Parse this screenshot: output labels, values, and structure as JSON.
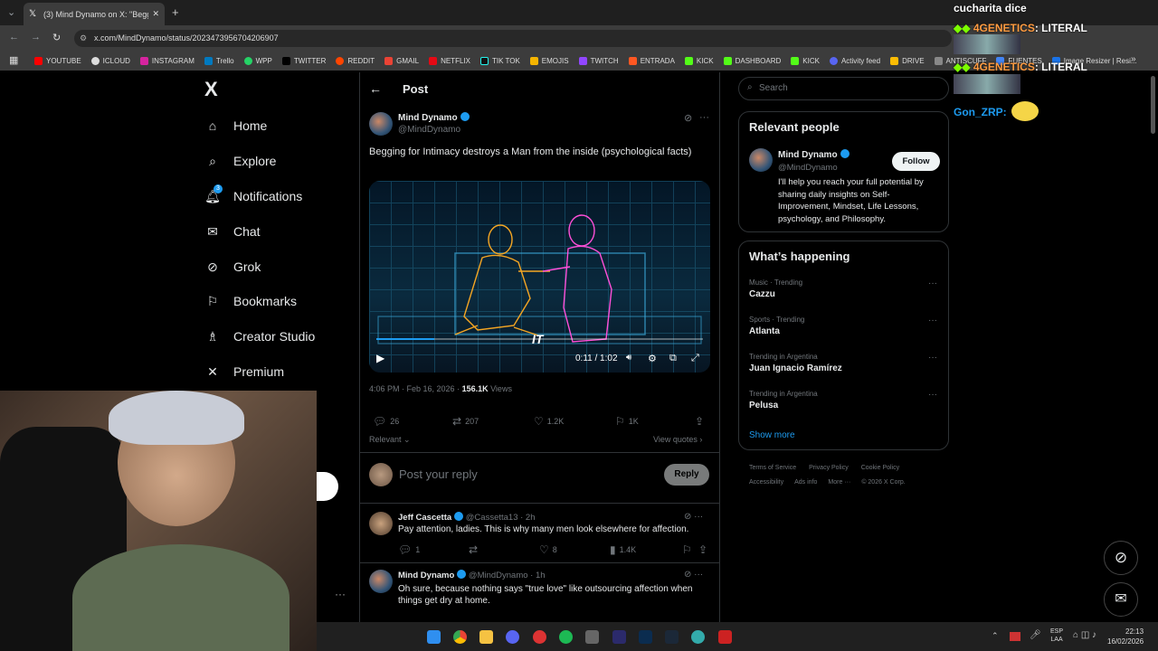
{
  "browser": {
    "tab_title": "(3) Mind Dynamo on X: \"Beggi",
    "url": "x.com/MindDynamo/status/2023473956704206907",
    "bookmarks": [
      "YOUTUBE",
      "ICLOUD",
      "INSTAGRAM",
      "Trello",
      "WPP",
      "TWITTER",
      "REDDIT",
      "GMAIL",
      "NETFLIX",
      "TIK TOK",
      "EMOJIS",
      "TWITCH",
      "ENTRADA",
      "KICK",
      "DASHBOARD",
      "KICK",
      "Activity feed",
      "DRIVE",
      "ANTISCUFF",
      "FUENTES",
      "Image Resizer | Resi..."
    ]
  },
  "sidebar": {
    "logo": "X",
    "items": [
      {
        "label": "Home",
        "icon": "home-icon"
      },
      {
        "label": "Explore",
        "icon": "search-icon"
      },
      {
        "label": "Notifications",
        "icon": "bell-icon"
      },
      {
        "label": "Chat",
        "icon": "mail-icon"
      },
      {
        "label": "Grok",
        "icon": "grok-icon"
      },
      {
        "label": "Bookmarks",
        "icon": "bookmark-icon"
      },
      {
        "label": "Creator Studio",
        "icon": "creator-icon"
      },
      {
        "label": "Premium",
        "icon": "x-icon"
      }
    ],
    "notification_count": "3"
  },
  "post": {
    "header": "Post",
    "author_name": "Mind Dynamo",
    "author_handle": "@MindDynamo",
    "text": "Begging for Intimacy destroys a Man from the inside (psychological facts)",
    "video_time": "0:11 / 1:02",
    "video_watermark": "IT",
    "timestamp": "4:06 PM · Feb 16, 2026 · ",
    "views_count": "156.1K",
    "views_label": " Views",
    "replies": "26",
    "reposts": "207",
    "likes": "1.2K",
    "bookmarks": "1K",
    "sort_label": "Relevant",
    "view_quotes": "View quotes",
    "reply_placeholder": "Post your reply",
    "reply_button": "Reply"
  },
  "replies": [
    {
      "name": "Jeff Cascetta",
      "handle": "@Cassetta13 · 2h",
      "text": "Pay attention, ladies. This is why many men look elsewhere for affection.",
      "replies": "1",
      "likes": "8",
      "views": "1.4K"
    },
    {
      "name": "Mind Dynamo",
      "handle": "@MindDynamo · 1h",
      "text": "Oh sure, because nothing says \"true love\" like outsourcing affection when things get dry at home."
    }
  ],
  "right": {
    "search_placeholder": "Search",
    "relevant_title": "Relevant people",
    "person_name": "Mind Dynamo",
    "person_handle": "@MindDynamo",
    "follow": "Follow",
    "bio": "I'll help you reach your full potential by sharing daily insights on Self-Improvement, Mindset, Life Lessons, psychology, and Philosophy.",
    "happening_title": "What’s happening",
    "trends": [
      {
        "cat": "Music · Trending",
        "name": "Cazzu"
      },
      {
        "cat": "Sports · Trending",
        "name": "Atlanta"
      },
      {
        "cat": "Trending in Argentina",
        "name": "Juan Ignacio Ramírez"
      },
      {
        "cat": "Trending in Argentina",
        "name": "Pelusa"
      }
    ],
    "show_more": "Show more",
    "footer1": [
      "Terms of Service",
      "Privacy Policy",
      "Cookie Policy"
    ],
    "footer2": [
      "Accessibility",
      "Ads info",
      "More ···",
      "© 2026 X Corp."
    ]
  },
  "stream_chat": [
    {
      "user": "cucharita dice",
      "text": ""
    },
    {
      "user": "4GENETICS",
      "text": "LITERAL"
    },
    {
      "user": "4GENETICS",
      "text": "LITERAL"
    },
    {
      "user": "Gon_ZRP:",
      "text": ""
    }
  ],
  "taskbar": {
    "lang": "ESP",
    "lang2": "LAA",
    "time": "22:13",
    "date": "16/02/2026"
  }
}
